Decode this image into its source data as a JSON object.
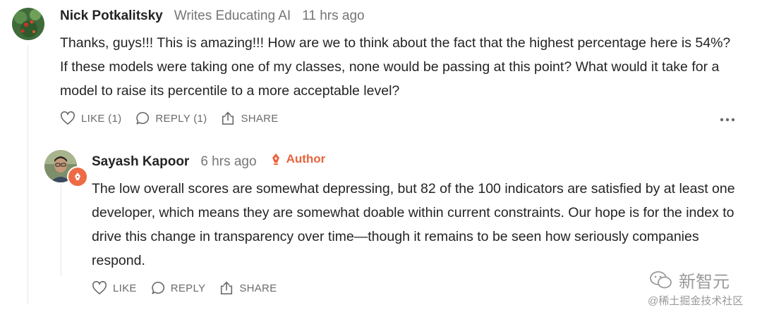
{
  "comment": {
    "author": "Nick Potkalitsky",
    "subtitle": "Writes Educating AI",
    "time": "11 hrs ago",
    "body": "Thanks, guys!!! This is amazing!!! How are we to think about the fact that the highest percentage here is 54%? If these models were taking one of my classes, none would be passing at this point? What would it take for a model to raise its percentile to a more acceptable level?",
    "like_label": "LIKE (1)",
    "reply_label": "REPLY (1)",
    "share_label": "SHARE"
  },
  "reply": {
    "author": "Sayash Kapoor",
    "time": "6 hrs ago",
    "author_tag": "Author",
    "body": "The low overall scores are somewhat depressing, but 82 of the 100 indicators are satisfied by at least one developer, which means they are somewhat doable within current constraints. Our hope is for the index to drive this change in transparency over time—though it remains to be seen how seriously companies respond.",
    "like_label": "LIKE",
    "reply_label": "REPLY",
    "share_label": "SHARE"
  },
  "watermark": {
    "line1": "新智元",
    "line2": "@稀土掘金技术社区"
  },
  "colors": {
    "accent": "#e8643c",
    "text": "#242424",
    "muted": "#757575"
  }
}
